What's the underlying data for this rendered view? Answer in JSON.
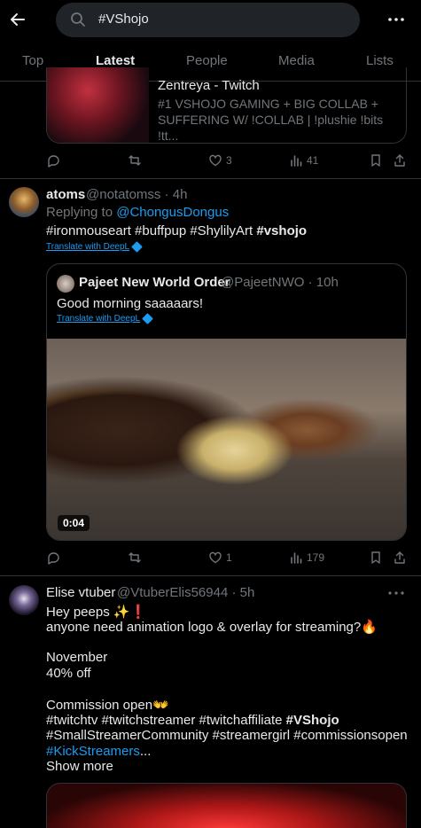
{
  "search": {
    "query": "#VShojo"
  },
  "tabs": [
    "Top",
    "Latest",
    "People",
    "Media",
    "Lists"
  ],
  "tweet0": {
    "card_title": "Zentreya - Twitch",
    "card_desc": "#1 VSHOJO GAMING + BIG COLLAB + SUFFERING W/ !COLLAB | !plushie !bits !tt...",
    "likes": "3",
    "views": "41"
  },
  "tweet1": {
    "name": "atoms",
    "handle": "@notatomss",
    "time": "4h",
    "replying_prefix": "Replying to",
    "replying_to": "@ChongusDongus",
    "hashtags": "#ironmouseart #buffpup #ShylilyArt",
    "hashtag_bold": "#vshojo",
    "translate": "Translate with DeepL",
    "quote": {
      "name": "Pajeet New World Order",
      "handle": "@PajeetNWO",
      "time": "10h",
      "text": "Good morning saaaaars!",
      "translate": "Translate with DeepL",
      "duration": "0:04"
    },
    "likes": "1",
    "views": "179"
  },
  "tweet2": {
    "name": "Elise vtuber",
    "handle": "@VtuberElis56944",
    "time": "5h",
    "line1": "Hey peeps ✨❗",
    "line2": " anyone need animation logo & overlay for streaming?🔥",
    "line3": "November",
    "line4": "40% off",
    "line5": "Commission open👐",
    "tags1": "#twitchtv #twitchstreamer #twitchaffiliate",
    "tags1_bold": "#VShojo",
    "tags2": "#SmallStreamerCommunity #streamergirl #commissionsopen",
    "tags3": "#KickStreamers",
    "tags3_suffix": "...",
    "show_more": "Show more"
  }
}
